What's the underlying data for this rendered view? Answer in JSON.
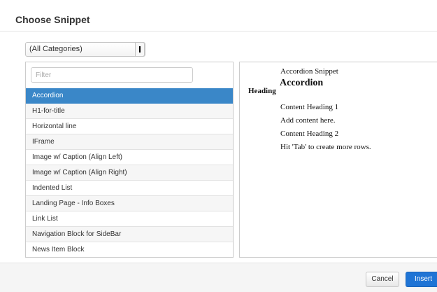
{
  "dialog": {
    "title": "Choose Snippet"
  },
  "category_select": {
    "value": "(All Categories)"
  },
  "filter": {
    "placeholder": "Filter"
  },
  "snippets": [
    "Accordion",
    "H1-for-title",
    "Horizontal line",
    "IFrame",
    "Image w/ Caption (Align Left)",
    "Image w/ Caption (Align Right)",
    "Indented List",
    "Landing Page - Info Boxes",
    "Link List",
    "Navigation Block for SideBar",
    "News Item Block"
  ],
  "selected_snippet": "Accordion",
  "preview": {
    "snippet_title": "Accordion Snippet",
    "heading_label": "Heading",
    "heading": "Accordion",
    "lines": [
      "Content Heading 1",
      "Add content here.",
      "Content Heading 2",
      "Hit 'Tab' to create more rows."
    ]
  },
  "footer": {
    "cancel_label": "Cancel",
    "insert_label": "Insert"
  },
  "colors": {
    "selected_row": "#3a87c8",
    "primary_button": "#1f74d5"
  }
}
